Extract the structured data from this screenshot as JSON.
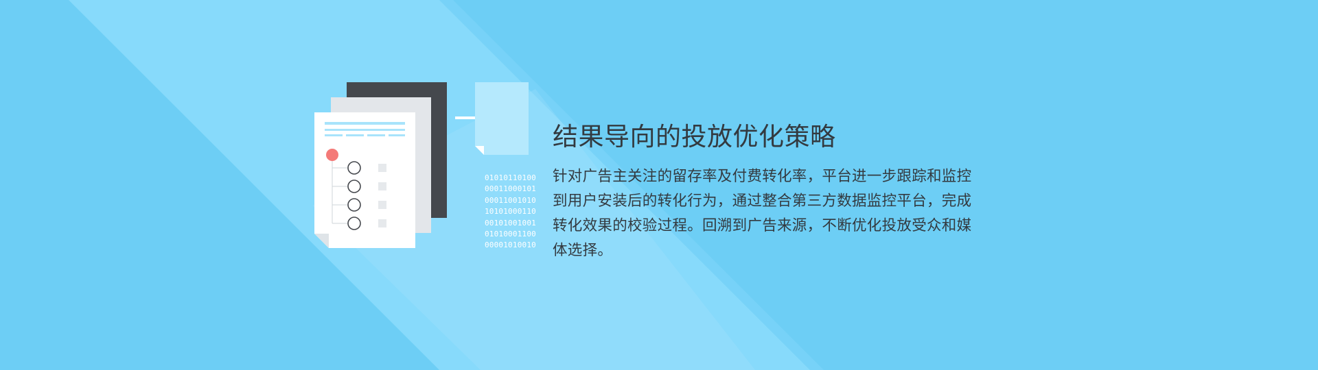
{
  "section": {
    "title": "结果导向的投放优化策略",
    "description": "针对广告主关注的留存率及付费转化率，平台进一步跟踪和监控到用户安装后的转化行为，通过整合第三方数据监控平台，完成转化效果的校验过程。回溯到广告来源，不断优化投放受众和媒体选择。"
  },
  "illustration": {
    "binary_lines": [
      "01010110100",
      "00011000101",
      "00011001010",
      "10101000110",
      "00101001001",
      "01010001100",
      "00001010010"
    ],
    "icons": [
      "document-stack-icon",
      "arrow-right-icon",
      "blank-document-icon"
    ]
  },
  "colors": {
    "background": "#6dcef5",
    "light_band": "#8cdcfc",
    "dark_page": "#45484d",
    "gray_page": "#e3e6ea",
    "front_page": "#ffffff",
    "accent_line": "#a8e3fb",
    "red_dot": "#f47a78",
    "text": "#333a40"
  }
}
